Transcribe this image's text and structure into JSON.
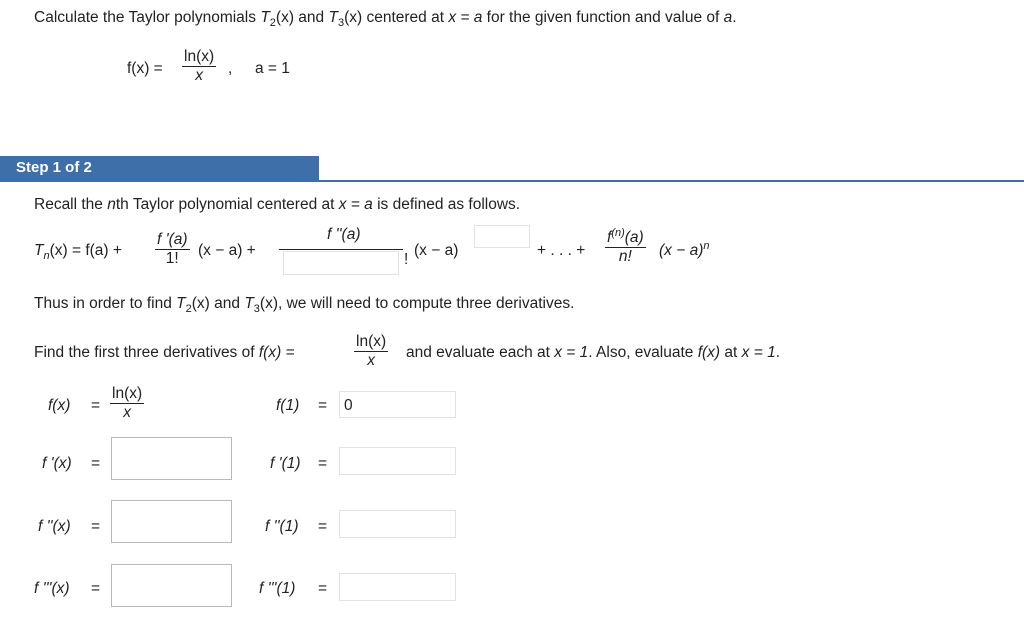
{
  "problem": {
    "prompt_prefix": "Calculate the Taylor polynomials ",
    "t2": "T",
    "t2_sub": "2",
    "t2_arg": "(x)",
    "and": " and ",
    "t3": "T",
    "t3_sub": "3",
    "t3_arg": "(x)",
    "prompt_mid": " centered at ",
    "x_eq_a": "x = a",
    "prompt_suffix": " for the given function and value of ",
    "a_var": "a",
    "period": ".",
    "fx_label": "f(x) =",
    "fx_num": "ln(x)",
    "fx_den": "x",
    "comma": ",",
    "a_value": "a = 1"
  },
  "step": {
    "label": "Step 1 of 2"
  },
  "content": {
    "recall_1": "Recall the ",
    "recall_nth": "n",
    "recall_2": "th Taylor polynomial centered at ",
    "recall_xa": "x = a",
    "recall_3": " is defined as follows.",
    "formula": {
      "tn": "T",
      "tn_sub": "n",
      "tn_rest": "(x) = f(a) +",
      "f1_num": "f '(a)",
      "f1_den": "1!",
      "term1": "(x − a) +",
      "f2_num": "f ''(a)",
      "excl": "!",
      "term2": "(x − a)",
      "dots": "+ . . . +",
      "fn_num_f": "f",
      "fn_num_sup": "(n)",
      "fn_num_rest": "(a)",
      "fn_den": "n!",
      "term_n": "(x − a)",
      "term_n_sup": "n"
    },
    "thus_1": "Thus in order to find ",
    "thus_t2": "T",
    "thus_t2_sub": "2",
    "thus_t2_arg": "(x)",
    "thus_and": " and ",
    "thus_t3": "T",
    "thus_t3_sub": "3",
    "thus_t3_arg": "(x)",
    "thus_2": ", we will need to compute three derivatives.",
    "find_1": "Find the first three derivatives of ",
    "find_fx": "f(x) =",
    "find_num": "ln(x)",
    "find_den": "x",
    "find_2": "and evaluate each at ",
    "find_x1": "x = 1",
    "find_3": ". Also, evaluate ",
    "find_fx2": "f(x)",
    "find_4": " at ",
    "find_x1b": "x = 1",
    "find_5": "."
  },
  "derivatives": {
    "f_label": "f(x)",
    "eq": "=",
    "f_num": "ln(x)",
    "f_den": "x",
    "f1_label": "f(1)",
    "f1_value": "0",
    "fp_label": "f '(x)",
    "fp1_label": "f '(1)",
    "fpp_label": "f ''(x)",
    "fpp1_label": "f ''(1)",
    "fppp_label": "f '''(x)",
    "fppp1_label": "f '''(1)"
  }
}
